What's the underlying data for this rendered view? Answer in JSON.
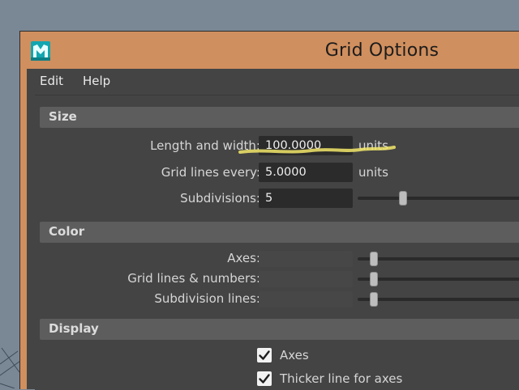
{
  "window": {
    "title": "Grid Options"
  },
  "menubar": {
    "edit": "Edit",
    "help": "Help"
  },
  "sections": {
    "size": {
      "title": "Size",
      "length_label": "Length and width:",
      "length_value": "100.0000",
      "length_units": "units",
      "grid_lines_label": "Grid lines every:",
      "grid_lines_value": "5.0000",
      "grid_lines_units": "units",
      "subdivisions_label": "Subdivisions:",
      "subdivisions_value": "5"
    },
    "color": {
      "title": "Color",
      "axes_label": "Axes:",
      "grid_lines_numbers_label": "Grid lines & numbers:",
      "subdivision_lines_label": "Subdivision lines:",
      "swatch_color": "#474747"
    },
    "display": {
      "title": "Display",
      "axes_label": "Axes",
      "axes_checked": true,
      "thicker_label": "Thicker line for axes",
      "thicker_checked": true
    }
  },
  "colors": {
    "title_bar": "#d08f5e",
    "panel": "#444444",
    "section_header": "#5d5d5d",
    "field": "#2b2b2b",
    "annotation": "#f3e86a"
  },
  "icons": {
    "app": "maya-app-icon",
    "check": "checkmark-icon"
  }
}
